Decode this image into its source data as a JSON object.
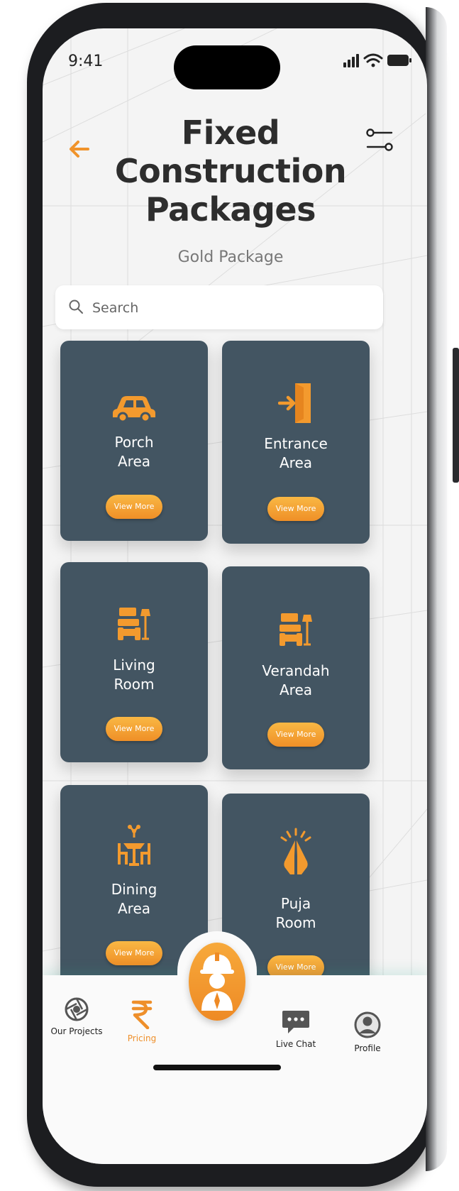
{
  "status_bar": {
    "time": "9:41"
  },
  "header": {
    "title_lines": [
      "Fixed",
      "Construction",
      "Packages"
    ],
    "subtitle": "Gold Package",
    "back_icon": "arrow-left-icon",
    "filter_icon": "sliders-icon"
  },
  "search": {
    "placeholder": "Search",
    "value": ""
  },
  "cards": [
    {
      "label": "Porch\nArea",
      "icon": "car-icon",
      "button": "View More"
    },
    {
      "label": "Entrance\nArea",
      "icon": "door-enter-icon",
      "button": "View More"
    },
    {
      "label": "Living\nRoom",
      "icon": "sofa-lamp-icon",
      "button": "View More"
    },
    {
      "label": "Verandah\nArea",
      "icon": "sofa-lamp-icon",
      "button": "View More"
    },
    {
      "label": "Dining\nArea",
      "icon": "dining-table-icon",
      "button": "View More"
    },
    {
      "label": "Puja\nRoom",
      "icon": "praying-hands-icon",
      "button": "View More"
    }
  ],
  "bottom_nav": {
    "items": [
      {
        "label": "Our Projects",
        "icon": "aperture-icon",
        "active": false
      },
      {
        "label": "Pricing",
        "icon": "rupee-icon",
        "active": true
      },
      {
        "label": "Live Chat",
        "icon": "chat-bubble-icon",
        "active": false
      },
      {
        "label": "Profile",
        "icon": "user-circle-icon",
        "active": false
      }
    ],
    "center_icon": "engineer-helmet-icon"
  },
  "colors": {
    "accent": "#EF8F27",
    "card_bg": "#435562",
    "title": "#2D2D2D",
    "screen_bg": "#F4F4F4"
  }
}
